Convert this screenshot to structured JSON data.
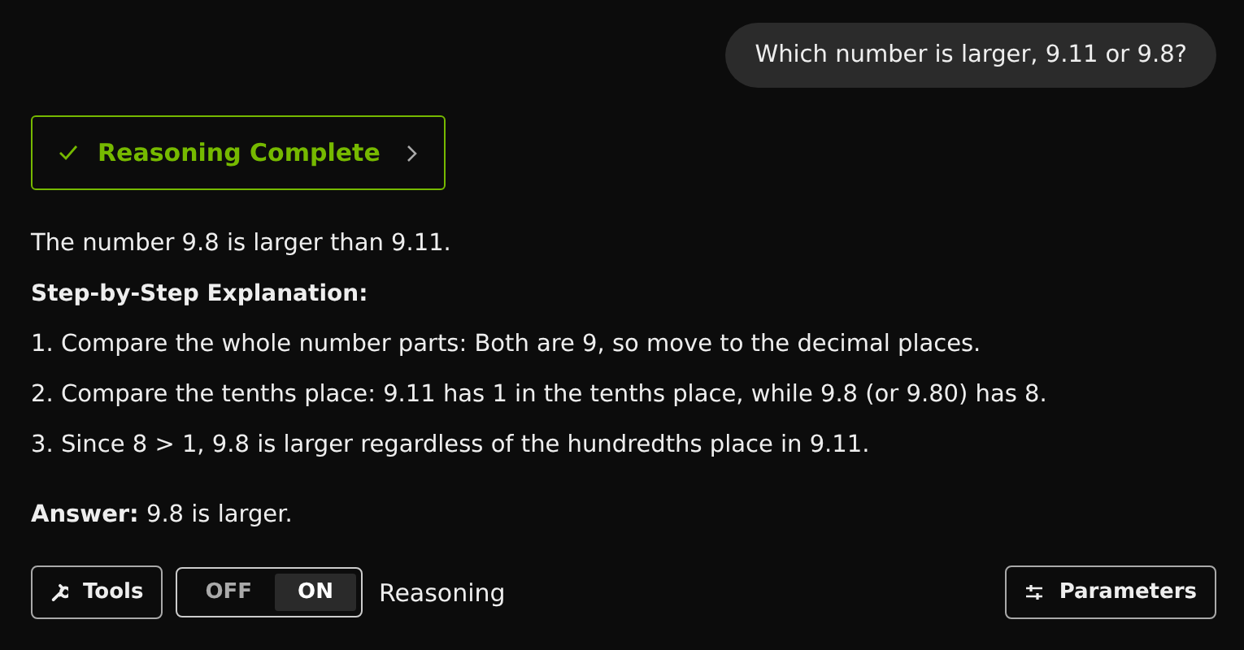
{
  "question": "Which number is larger, 9.11 or 9.8?",
  "reasoning_button": {
    "label": "Reasoning Complete",
    "complete": true
  },
  "answer_intro": "The number 9.8 is larger than 9.11.",
  "heading": "Step-by-Step Explanation:",
  "steps": [
    "1. Compare the whole number parts: Both are 9, so move to the decimal places.",
    "2. Compare the tenths place: 9.11 has 1 in the tenths place, while 9.8 (or 9.80) has 8.",
    "3. Since 8 > 1, 9.8 is larger regardless of the hundredths place in 9.11."
  ],
  "answer": "**Answer:** 9.8 is larger.",
  "toolbar": {
    "tools": "Tools",
    "toggle": [
      {
        "label": "OFF",
        "selected": false
      },
      {
        "label": "ON",
        "selected": true
      }
    ],
    "toggle_label": "Reasoning",
    "parameters": "Parameters"
  }
}
